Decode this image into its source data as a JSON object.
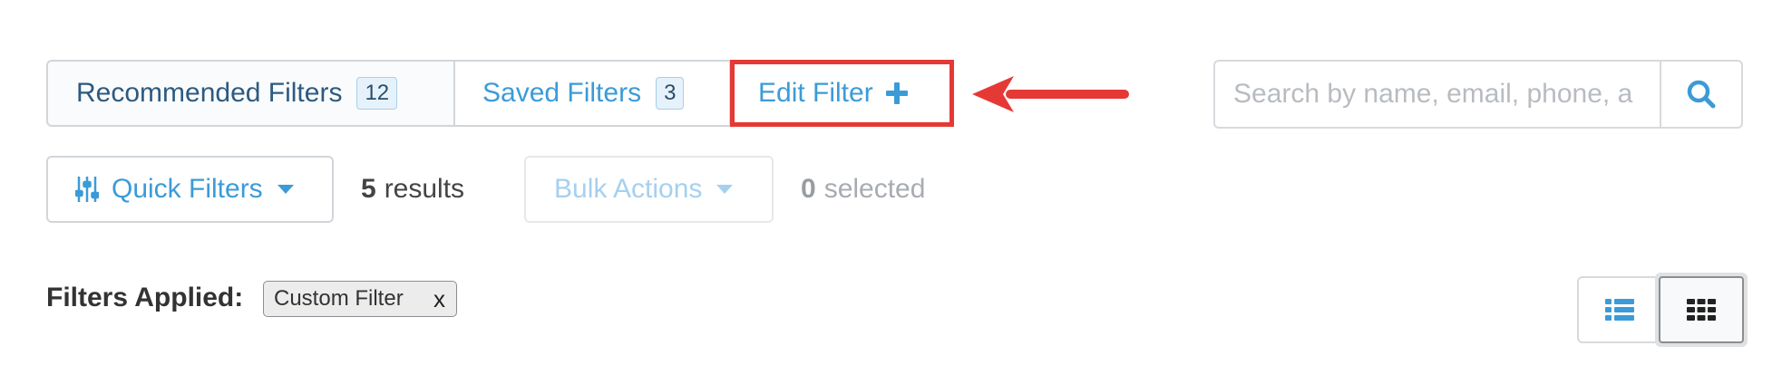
{
  "filter_tabs": {
    "recommended": {
      "label": "Recommended Filters",
      "count": "12"
    },
    "saved": {
      "label": "Saved Filters",
      "count": "3"
    },
    "edit": {
      "label": "Edit Filter"
    }
  },
  "search": {
    "placeholder": "Search by name, email, phone, a"
  },
  "toolbar": {
    "quick_filters_label": "Quick Filters",
    "results_count": "5",
    "results_label": "results",
    "bulk_actions_label": "Bulk Actions",
    "selected_count": "0",
    "selected_label": "selected"
  },
  "applied": {
    "label": "Filters Applied:",
    "chips": [
      {
        "label": "Custom Filter",
        "close": "x"
      }
    ]
  },
  "colors": {
    "accent": "#3b9bd8",
    "highlight": "#e53935",
    "dark_text": "#333333"
  },
  "icons": {
    "edit_plus": "plus-icon",
    "search": "search-icon",
    "quick_filters": "sliders-icon",
    "list_view": "list-view-icon",
    "grid_view": "grid-view-icon",
    "annotation_arrow": "arrow-left-icon"
  }
}
